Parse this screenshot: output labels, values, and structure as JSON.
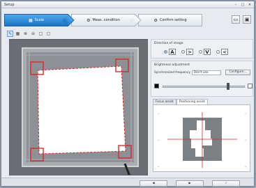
{
  "window": {
    "title": "Setup"
  },
  "tabs": [
    {
      "label": "Scale",
      "icon": "grid-icon"
    },
    {
      "label": "Meas. condition",
      "icon": "settings-icon"
    },
    {
      "label": "Confirm setting",
      "icon": "settings-icon"
    }
  ],
  "header_buttons": {
    "open": "folder-icon",
    "save": "save-icon"
  },
  "toolbar": {
    "tools": [
      "pointer-icon",
      "grid-icon",
      "zoom-in-icon",
      "zoom-out-icon",
      "fit-icon",
      "fit-all-icon"
    ]
  },
  "direction": {
    "title": "Direction of image",
    "options": [
      {
        "glyph": "A",
        "selected": true
      },
      {
        "glyph": ">",
        "selected": false
      },
      {
        "glyph": "V",
        "selected": false
      },
      {
        "glyph": "<",
        "selected": false
      }
    ]
  },
  "brightness": {
    "title": "Brightness adjustment",
    "sync_label": "Synchronized frequency",
    "sync_value": "Don't use",
    "configure_label": "Configure...",
    "slider_level": 0.8
  },
  "preview_tabs": [
    {
      "label": "Focus assist",
      "active": false
    },
    {
      "label": "Positioning assist",
      "active": true
    }
  ],
  "colors": {
    "accent": "#1d74c6",
    "marker": "#d42a2a",
    "swatch_dark": "#000000",
    "swatch_light": "#ffffff"
  }
}
